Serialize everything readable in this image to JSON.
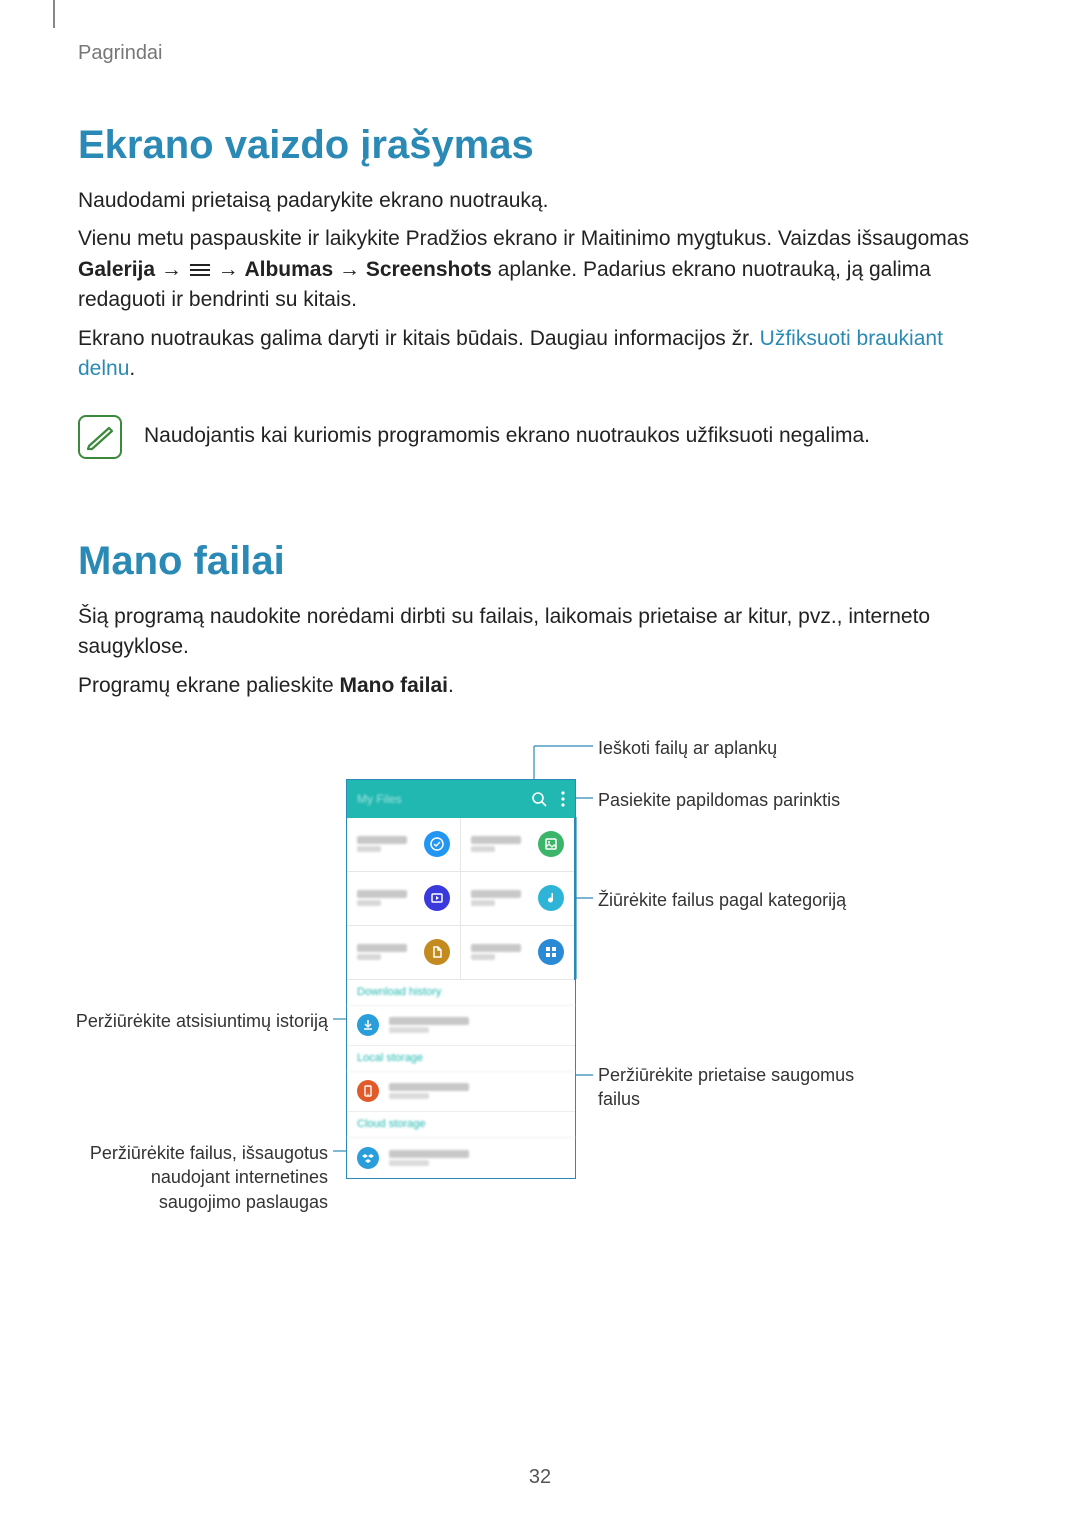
{
  "breadcrumb": "Pagrindai",
  "section1": {
    "title": "Ekrano vaizdo įrašymas",
    "p1": "Naudodami prietaisą padarykite ekrano nuotrauką.",
    "p2_a": "Vienu metu paspauskite ir laikykite Pradžios ekrano ir Maitinimo mygtukus. Vaizdas išsaugomas ",
    "p2_bold1": "Galerija",
    "p2_arrow": " → ",
    "p2_bold2": "Albumas",
    "p2_bold3": "Screenshots",
    "p2_b": " aplanke. Padarius ekrano nuotrauką, ją galima redaguoti ir bendrinti su kitais.",
    "p3_a": "Ekrano nuotraukas galima daryti ir kitais būdais. Daugiau informacijos žr. ",
    "p3_link": "Užfiksuoti braukiant delnu",
    "p3_b": ".",
    "note": "Naudojantis kai kuriomis programomis ekrano nuotraukos užfiksuoti negalima."
  },
  "section2": {
    "title": "Mano failai",
    "p1": "Šią programą naudokite norėdami dirbti su failais, laikomais prietaise ar kitur, pvz., interneto saugyklose.",
    "p2_a": "Programų ekrane palieskite ",
    "p2_bold": "Mano failai",
    "p2_b": "."
  },
  "callouts": {
    "search": "Ieškoti failų ar aplankų",
    "more": "Pasiekite papildomas parinktis",
    "categories": "Žiūrėkite failus pagal kategoriją",
    "downloads": "Peržiūrėkite atsisiuntimų istoriją",
    "device": "Peržiūrėkite prietaise saugomus failus",
    "cloud": "Peržiūrėkite failus, išsaugotus naudojant internetines saugojimo paslaugas"
  },
  "phone": {
    "title": "My Files",
    "categories": [
      {
        "name": "Recent files",
        "color": "#2196f3",
        "glyph": "checkmark"
      },
      {
        "name": "Images",
        "color": "#3bb56a",
        "glyph": "image"
      },
      {
        "name": "Videos",
        "color": "#3a3adc",
        "glyph": "video"
      },
      {
        "name": "Audio",
        "color": "#2db4d6",
        "glyph": "note"
      },
      {
        "name": "Documents",
        "color": "#c28a1f",
        "glyph": "doc"
      },
      {
        "name": "Downloaded apps",
        "color": "#2a8ad6",
        "glyph": "apps"
      }
    ],
    "sections": [
      {
        "label": "Download history",
        "icon_color": "#2a9edb",
        "glyph": "download"
      },
      {
        "label": "Local storage",
        "icon_color": "#e05a2a",
        "glyph": "device"
      },
      {
        "label": "Cloud storage",
        "icon_color": "#2a9edb",
        "glyph": "dropbox"
      }
    ]
  },
  "page_number": "32"
}
